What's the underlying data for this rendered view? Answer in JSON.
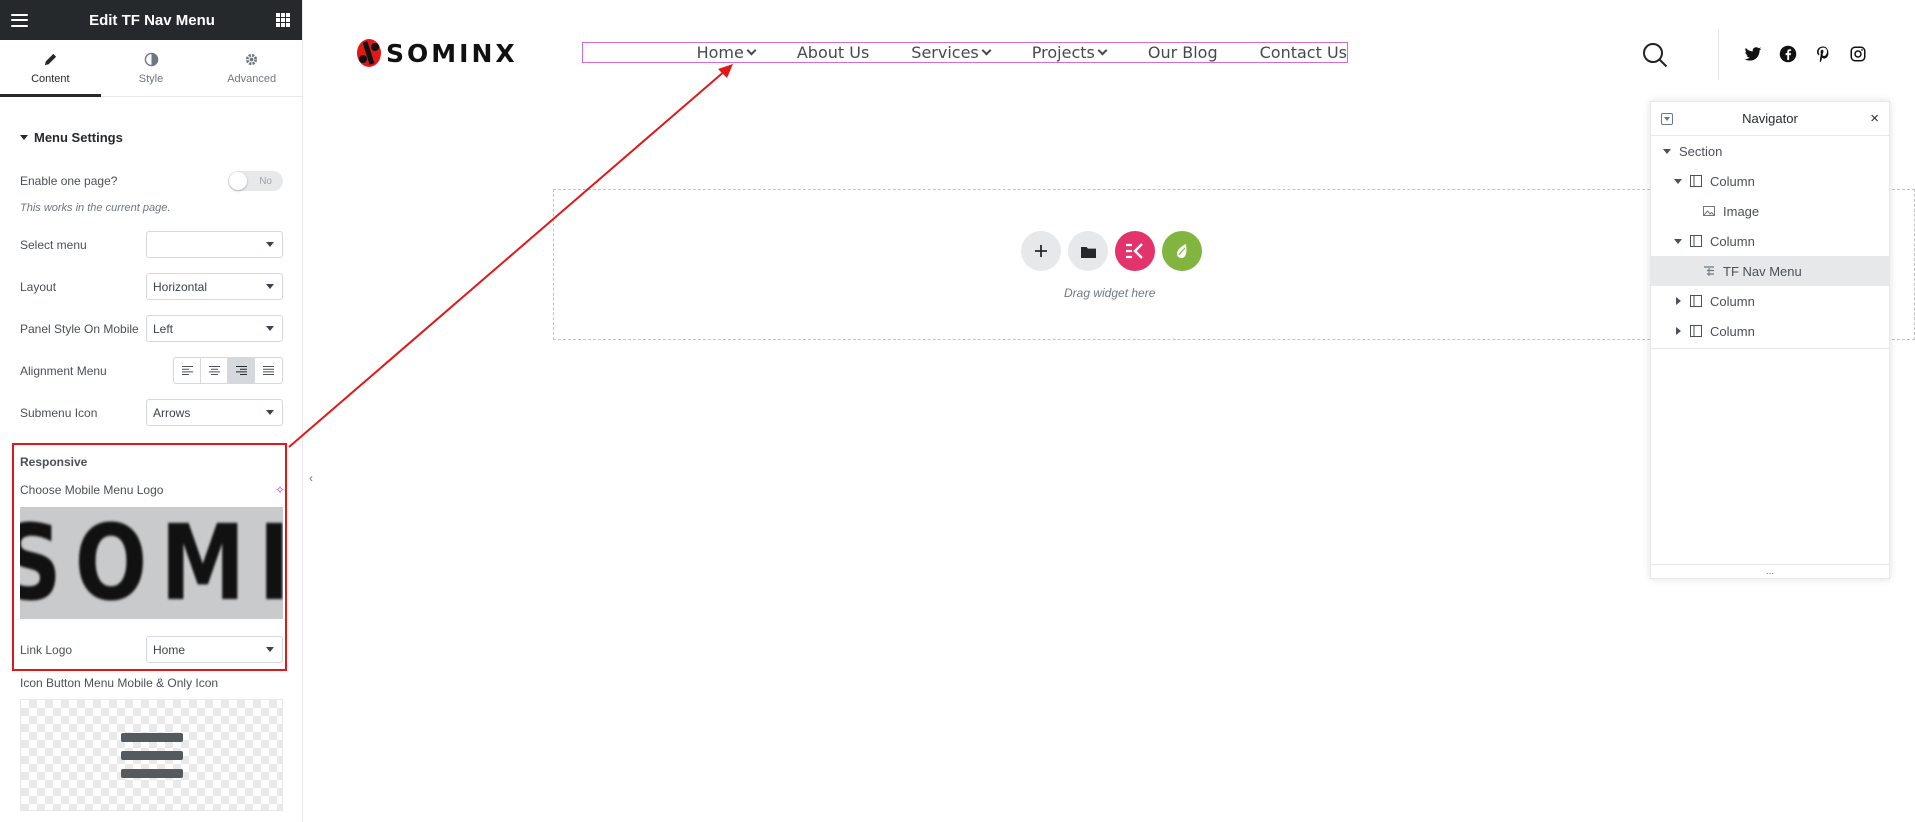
{
  "panel": {
    "title": "Edit TF Nav Menu",
    "tabs": [
      {
        "label": "Content",
        "icon": "pencil-icon"
      },
      {
        "label": "Style",
        "icon": "half-circle-icon"
      },
      {
        "label": "Advanced",
        "icon": "gear-icon"
      }
    ],
    "section_title": "Menu Settings",
    "enable_one_page": {
      "label": "Enable one page?",
      "toggle_text": "No",
      "note": "This works in the current page."
    },
    "select_menu": {
      "label": "Select menu",
      "value": ""
    },
    "layout": {
      "label": "Layout",
      "value": "Horizontal"
    },
    "panel_style": {
      "label": "Panel Style On Mobile",
      "value": "Left"
    },
    "alignment": {
      "label": "Alignment Menu",
      "active_index": 2
    },
    "submenu_icon": {
      "label": "Submenu Icon",
      "value": "Arrows"
    },
    "responsive": {
      "title": "Responsive",
      "choose_logo_label": "Choose Mobile Menu Logo",
      "logo_preview_text": "SOMI",
      "link_logo": {
        "label": "Link Logo",
        "value": "Home"
      }
    },
    "icon_button_label": "Icon Button Menu Mobile & Only Icon"
  },
  "site": {
    "logo_text": "SOMINX",
    "nav": [
      {
        "label": "Home",
        "has_submenu": true
      },
      {
        "label": "About Us",
        "has_submenu": false
      },
      {
        "label": "Services",
        "has_submenu": true
      },
      {
        "label": "Projects",
        "has_submenu": true
      },
      {
        "label": "Our Blog",
        "has_submenu": false
      },
      {
        "label": "Contact Us",
        "has_submenu": false
      }
    ],
    "social_icons": [
      "twitter-icon",
      "facebook-icon",
      "pinterest-icon",
      "instagram-icon"
    ]
  },
  "dropzone": {
    "text": "Drag widget here",
    "buttons": [
      "add-icon",
      "folder-icon",
      "elementor-kit-icon",
      "envato-leaf-icon"
    ]
  },
  "navigator": {
    "title": "Navigator",
    "items": [
      {
        "label": "Section",
        "level": 0,
        "expanded": true,
        "icon": ""
      },
      {
        "label": "Column",
        "level": 1,
        "expanded": true,
        "icon": "column-icon"
      },
      {
        "label": "Image",
        "level": 2,
        "expanded": null,
        "icon": "image-icon"
      },
      {
        "label": "Column",
        "level": 1,
        "expanded": true,
        "icon": "column-icon"
      },
      {
        "label": "TF Nav Menu",
        "level": 2,
        "expanded": null,
        "icon": "nav-menu-icon",
        "selected": true
      },
      {
        "label": "Column",
        "level": 1,
        "expanded": false,
        "icon": "column-icon"
      },
      {
        "label": "Column",
        "level": 1,
        "expanded": false,
        "icon": "column-icon"
      }
    ],
    "footer": "..."
  },
  "colors": {
    "panel_header": "#26292c",
    "highlight_red": "#e01818",
    "nav_outline": "#d66bd6",
    "add_btn": "#e6e8ea",
    "elementor_pink": "#e2336b",
    "envato_green": "#82b440"
  }
}
